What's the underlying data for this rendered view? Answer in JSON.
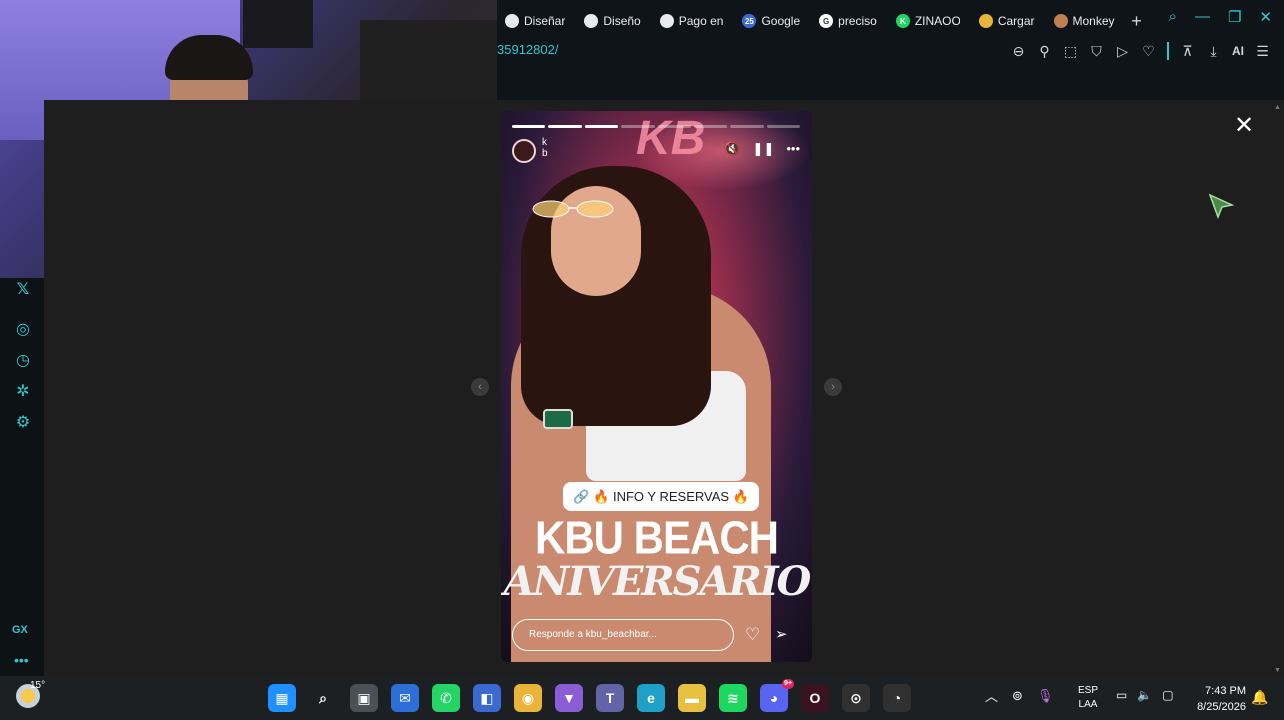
{
  "browser": {
    "tabs": [
      {
        "title": "Diseñar",
        "color": "#e8eaed",
        "glyph": ""
      },
      {
        "title": "Diseño",
        "color": "#e8eaed",
        "glyph": ""
      },
      {
        "title": "Pago en",
        "color": "#e8eaed",
        "glyph": ""
      },
      {
        "title": "Google",
        "color": "#3d6ad6",
        "glyph": "25"
      },
      {
        "title": "preciso",
        "color": "#ffffff",
        "glyph": "G"
      },
      {
        "title": "ZINAOO",
        "color": "#1ed760",
        "glyph": "K"
      },
      {
        "title": "Cargar",
        "color": "#e8b43a",
        "glyph": ""
      },
      {
        "title": "Monkey",
        "color": "#c08050",
        "glyph": ""
      }
    ],
    "new_tab_label": "+",
    "url_fragment": "35912802/",
    "ai_label": "AI"
  },
  "story": {
    "username_line1": "k",
    "username_line2": "b",
    "progress_segments": 8,
    "progress_done": 3,
    "sticker_text": "🔥 INFO Y RESERVAS 🔥",
    "headline": "KBU BEACH",
    "subhead": "ANIVERSARIO",
    "sign_text": "KB",
    "reply_placeholder": "Responde a kbu_beachbar..."
  },
  "taskbar": {
    "temperature": "15°",
    "apps": [
      {
        "name": "windows-start",
        "color": "#1e90ff",
        "glyph": "▦"
      },
      {
        "name": "search",
        "color": "transparent",
        "glyph": "⌕"
      },
      {
        "name": "task-view",
        "color": "#4a5055",
        "glyph": "▣"
      },
      {
        "name": "mail",
        "color": "#2d6fd8",
        "glyph": "✉"
      },
      {
        "name": "whatsapp",
        "color": "#25d366",
        "glyph": "✆"
      },
      {
        "name": "store",
        "color": "#3a6ad0",
        "glyph": "◧"
      },
      {
        "name": "chrome",
        "color": "#e8b43a",
        "glyph": "◉"
      },
      {
        "name": "brave",
        "color": "#8a5cd6",
        "glyph": "▼"
      },
      {
        "name": "teams",
        "color": "#6264a7",
        "glyph": "T"
      },
      {
        "name": "edge",
        "color": "#1fa0c8",
        "glyph": "e"
      },
      {
        "name": "explorer",
        "color": "#e8c040",
        "glyph": "▬"
      },
      {
        "name": "spotify",
        "color": "#1ed760",
        "glyph": "≋"
      },
      {
        "name": "discord",
        "color": "#5865f2",
        "glyph": "◕",
        "badge": "9+"
      },
      {
        "name": "opera-gx",
        "color": "#3a1220",
        "glyph": "O"
      },
      {
        "name": "obs",
        "color": "#303030",
        "glyph": "⊙"
      },
      {
        "name": "recorder",
        "color": "#303030",
        "glyph": "◔"
      }
    ],
    "lang_line1": "ESP",
    "lang_line2": "LAA",
    "time": "7:43 PM",
    "date": "8/25/2026"
  }
}
